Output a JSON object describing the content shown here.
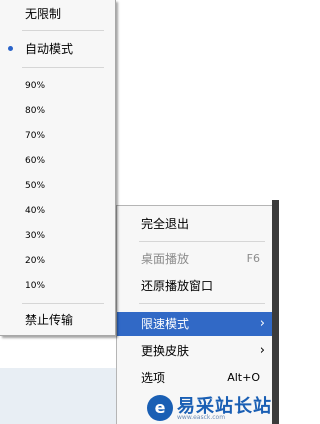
{
  "submenu": {
    "items": [
      {
        "label": "无限制",
        "selected": false
      },
      {
        "label": "自动模式",
        "selected": true
      },
      {
        "label": "90%",
        "selected": false
      },
      {
        "label": "80%",
        "selected": false
      },
      {
        "label": "70%",
        "selected": false
      },
      {
        "label": "60%",
        "selected": false
      },
      {
        "label": "50%",
        "selected": false
      },
      {
        "label": "40%",
        "selected": false
      },
      {
        "label": "30%",
        "selected": false
      },
      {
        "label": "20%",
        "selected": false
      },
      {
        "label": "10%",
        "selected": false
      },
      {
        "label": "禁止传输",
        "selected": false
      }
    ]
  },
  "menu": {
    "exit": "完全退出",
    "desktop_play": "桌面播放",
    "desktop_play_shortcut": "F6",
    "restore_window": "还原播放窗口",
    "speed_limit": "限速模式",
    "change_skin": "更换皮肤",
    "options": "选项",
    "options_shortcut": "Alt+O"
  },
  "watermark": {
    "name": "易采站长站",
    "url": "www.easck.com"
  },
  "colors": {
    "highlight": "#3169c6",
    "selected_dot": "#2a63c9",
    "disabled_text": "#8c8c8c"
  }
}
